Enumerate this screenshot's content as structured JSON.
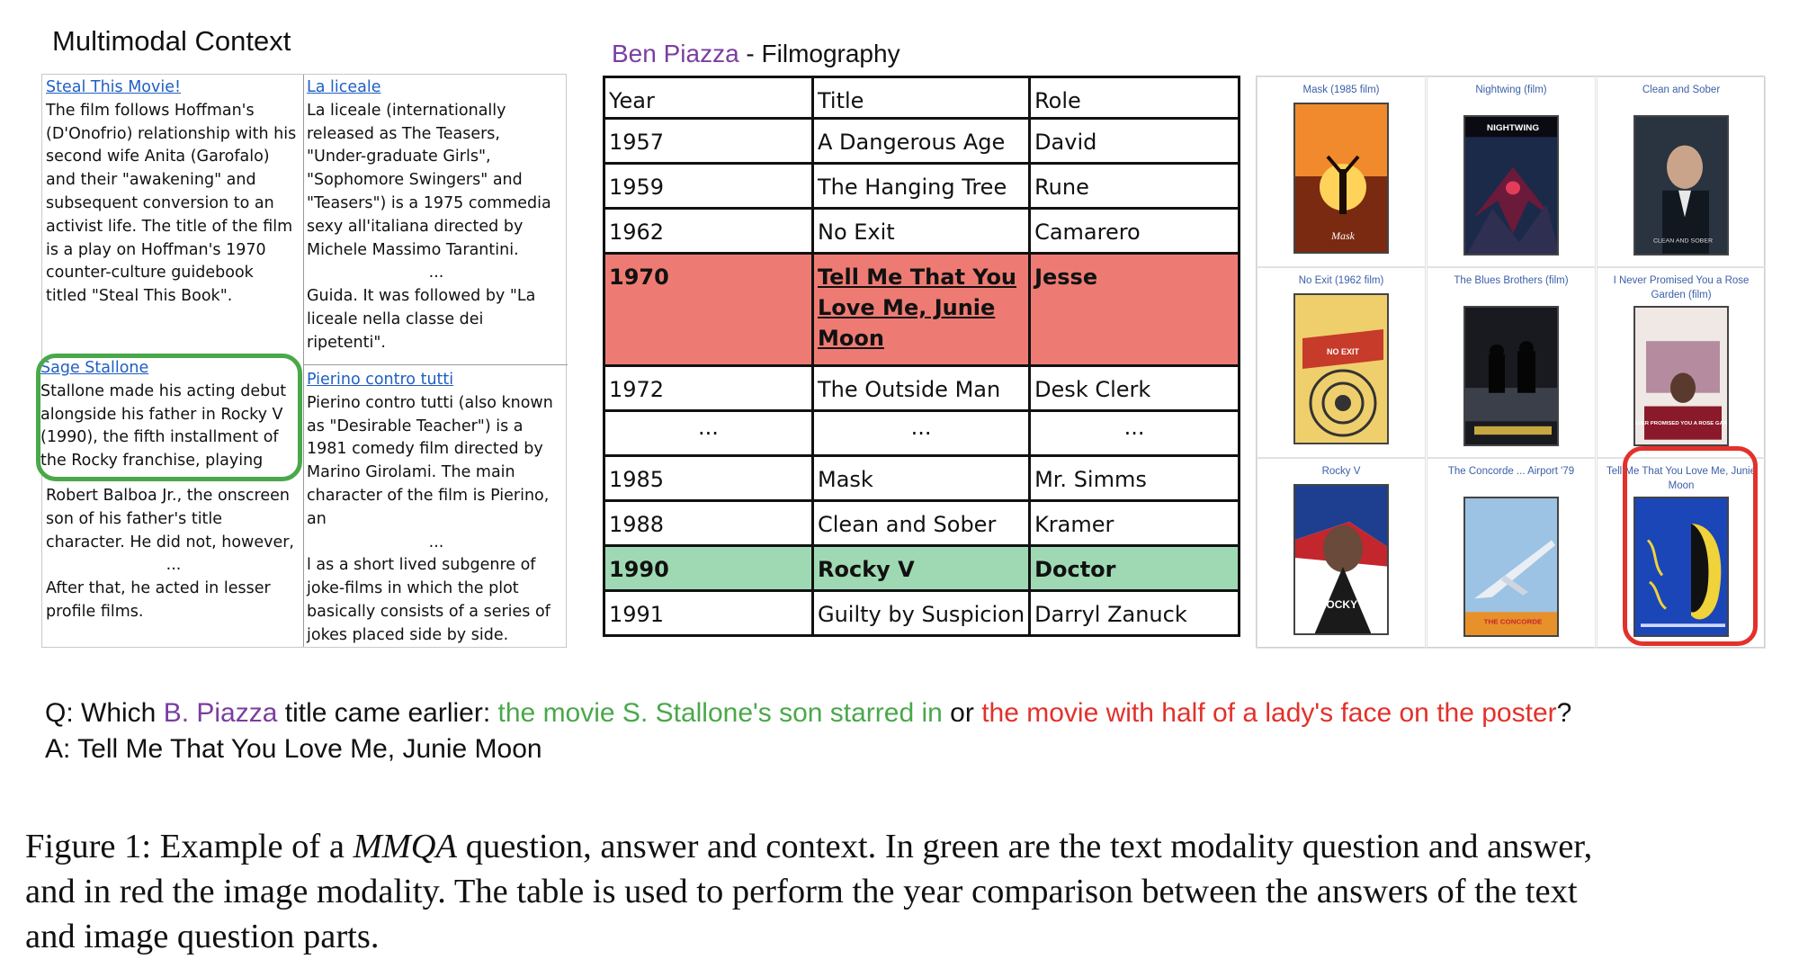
{
  "context_title": "Multimodal Context",
  "text_cells": [
    {
      "link": "Steal This Movie!",
      "lines": [
        "The film follows Hoffman's",
        "(D'Onofrio) relationship with his",
        "second wife Anita (Garofalo)",
        "and their \"awakening\" and",
        "subsequent conversion to an",
        "activist life. The title of the film",
        "is a play on Hoffman's 1970",
        "counter-culture guidebook",
        "titled \"Steal This Book\"."
      ]
    },
    {
      "link": "La liceale",
      "lines": [
        "La liceale (internationally",
        "released as The Teasers,",
        "\"Under-graduate Girls\",",
        "\"Sophomore Swingers\" and",
        "\"Teasers\") is a 1975 commedia",
        "sexy all'italiana directed by",
        "Michele Massimo Tarantini."
      ],
      "ellipsis": "...",
      "lines_after": [
        "Guida. It was followed by \"La",
        "liceale nella classe dei",
        "ripetenti\"."
      ]
    },
    {
      "link": "Sage Stallone",
      "lines": [
        "Stallone made his acting debut",
        "alongside his father in Rocky V",
        "(1990), the fifth installment of",
        "the Rocky franchise, playing",
        "Robert Balboa Jr., the onscreen",
        "son of his father's title",
        "character. He did not, however,"
      ],
      "ellipsis": "...",
      "lines_after": [
        "After that, he acted in lesser",
        "profile films."
      ]
    },
    {
      "link": "Pierino contro tutti",
      "lines": [
        "Pierino contro tutti (also known",
        "as \"Desirable Teacher\") is a",
        "1981 comedy film directed by",
        "Marino Girolami. The main",
        "character of the film is Pierino,",
        "an"
      ],
      "ellipsis": "...",
      "lines_after": [
        " l as a short lived subgenre of",
        "joke-films in which the plot",
        "basically consists of a series of",
        "jokes placed side by side."
      ]
    }
  ],
  "filmography": {
    "person": "Ben Piazza",
    "suffix": " - Filmography",
    "header": [
      "Year",
      "Title",
      "Role"
    ],
    "rows": [
      {
        "year": "1957",
        "title": "A Dangerous Age",
        "role": "David",
        "style": ""
      },
      {
        "year": "1959",
        "title": "The Hanging Tree",
        "role": "Rune",
        "style": ""
      },
      {
        "year": "1962",
        "title": "No Exit",
        "role": "Camarero",
        "style": ""
      },
      {
        "year": "1970",
        "title": "Tell Me That You Love Me, Junie Moon",
        "role": "Jesse",
        "style": "red"
      },
      {
        "year": "1972",
        "title": "The Outside Man",
        "role": "Desk Clerk",
        "style": ""
      },
      {
        "year": "...",
        "title": "...",
        "role": "...",
        "style": "ellrow"
      },
      {
        "year": "1985",
        "title": "Mask",
        "role": "Mr. Simms",
        "style": ""
      },
      {
        "year": "1988",
        "title": "Clean and Sober",
        "role": "Kramer",
        "style": ""
      },
      {
        "year": "1990",
        "title": "Rocky V",
        "role": "Doctor",
        "style": "green"
      },
      {
        "year": "1991",
        "title": "Guilty by Suspicion",
        "role": "Darryl Zanuck",
        "style": ""
      }
    ]
  },
  "posters": [
    {
      "caption": "Mask (1985 film)",
      "art": "mask",
      "bg": "#d4561f"
    },
    {
      "caption": "Nightwing (film)",
      "art": "nightwing",
      "bg": "#1c2a4a"
    },
    {
      "caption": "Clean and Sober",
      "art": "clean",
      "bg": "#26303c"
    },
    {
      "caption": "No Exit (1962 film)",
      "art": "noexit",
      "bg": "#e9c25b"
    },
    {
      "caption": "The Blues Brothers (film)",
      "art": "blues",
      "bg": "#16181d"
    },
    {
      "caption": "I Never Promised You a Rose Garden (film)",
      "art": "rose",
      "bg": "#ece6e2"
    },
    {
      "caption": "Rocky V",
      "art": "rocky",
      "bg": "#1e3f8f"
    },
    {
      "caption": "The Concorde ... Airport '79",
      "art": "concorde",
      "bg": "#8fb7dc"
    },
    {
      "caption": "Tell Me That You Love Me, Junie Moon",
      "art": "junie",
      "bg": "#1a46b8"
    }
  ],
  "poster_text": {
    "mask": "Mask",
    "nightwing": "NIGHTWING",
    "clean": "CLEAN AND SOBER",
    "noexit": "NO EXIT",
    "rose": "I NEVER PROMISED YOU A ROSE GARDEN",
    "rocky": "ROCKY V",
    "concorde": "THE CONCORDE"
  },
  "question": {
    "label": "Q: Which ",
    "person": "B. Piazza",
    "mid1": " title came earlier: ",
    "green_part": "the movie S. Stallone's son starred in",
    "mid2": " or ",
    "red_part": "the movie with half of a lady's face on the poster",
    "end": "?"
  },
  "answer": "A:  Tell Me That You Love Me, Junie Moon",
  "caption": {
    "prefix": "Figure 1: Example of a ",
    "italic": "MMQA",
    "line1_rest": " question, answer and context. In green are the text modality question and answer,",
    "line2": "and in red the image modality. The table is used to perform the year comparison between the answers of the text",
    "line3": "and image question parts."
  },
  "colors": {
    "purple": "#7b3ea0",
    "green": "#4aa84a",
    "red": "#e3312b",
    "red_row": "#ee7b73",
    "green_row": "#9fd9b3",
    "link": "#1f5fc2"
  }
}
